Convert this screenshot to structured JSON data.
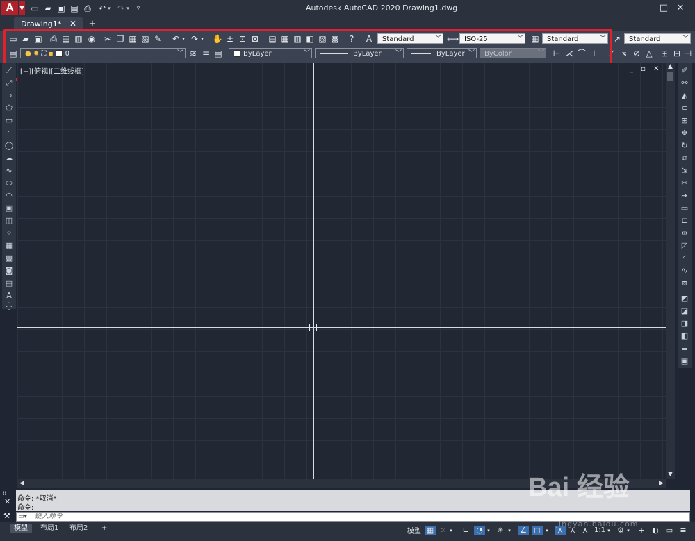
{
  "titlebar": {
    "app_logo": "A",
    "title": "Autodesk AutoCAD 2020    Drawing1.dwg",
    "quick_access_icons": [
      "new-icon",
      "open-icon",
      "save-icon",
      "saveas-icon",
      "print-icon",
      "undo-icon",
      "redo-icon",
      "customize-icon"
    ],
    "window_buttons": {
      "minimize": "—",
      "restore": "□",
      "close": "✕"
    }
  },
  "tabs": {
    "active_label": "Drawing1*",
    "close_glyph": "✕",
    "add_glyph": "+"
  },
  "toolbar": {
    "text_style": "Standard",
    "dim_style": "ISO-25",
    "table_style": "Standard",
    "multileader_style": "Standard",
    "layer": "0",
    "color": "ByLayer",
    "linetype": "ByLayer",
    "lineweight": "ByLayer",
    "plot_style": "ByColor"
  },
  "viewport": {
    "label": "[−][俯视][二维线框]",
    "controls": "_ ▫ ✕"
  },
  "command": {
    "history": [
      "命令: *取消*",
      "命令:"
    ],
    "placeholder": "键入命令"
  },
  "layout_tabs": [
    "模型",
    "布局1",
    "布局2"
  ],
  "status": {
    "model_label": "模型",
    "scale": "1:1"
  },
  "watermark": {
    "text": "Bai 经验",
    "sub": "jingyan.baidu.com"
  },
  "colors": {
    "accent_red": "#e5202d",
    "canvas": "#212834",
    "toolbar": "#3b4353"
  }
}
